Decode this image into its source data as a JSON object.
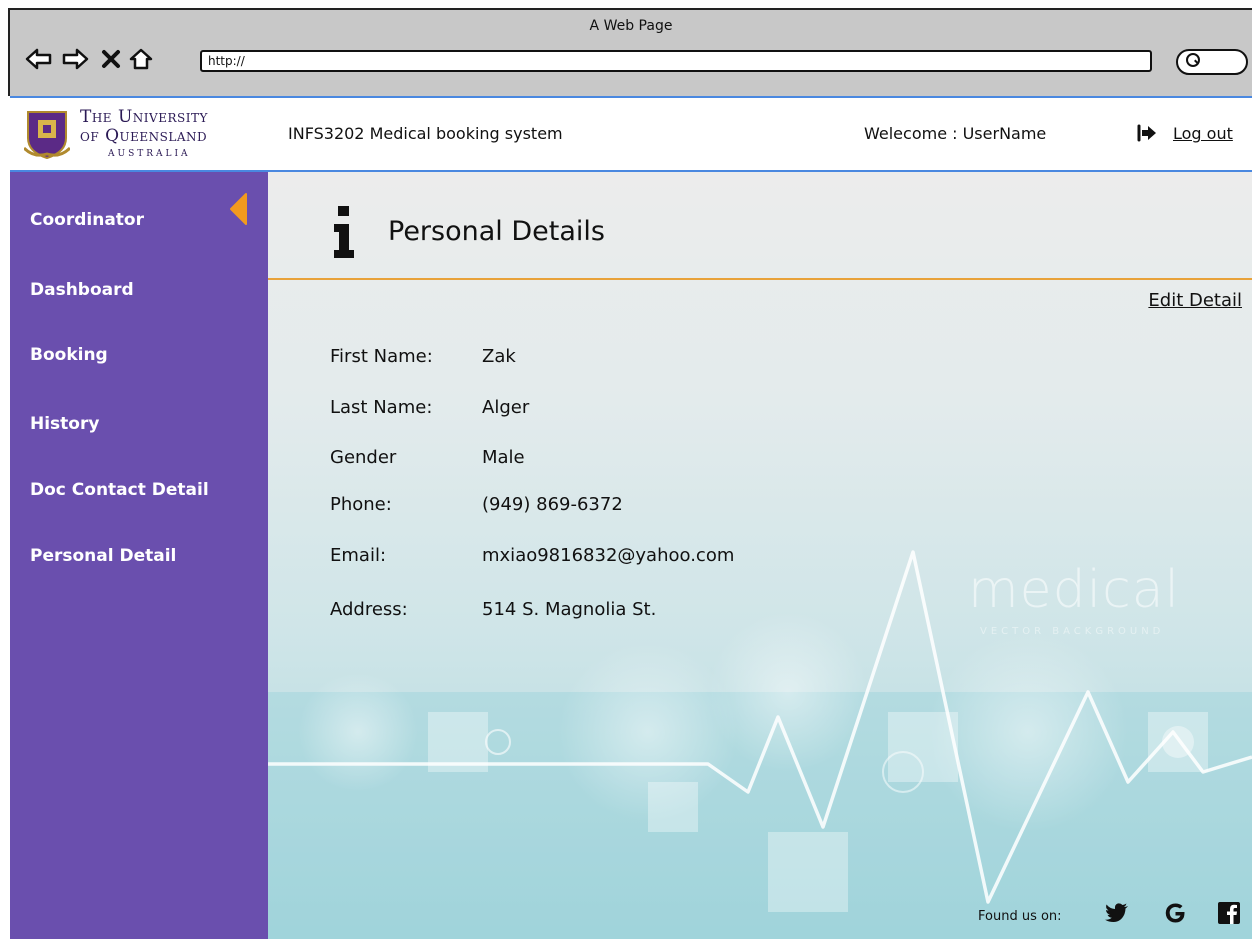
{
  "browser": {
    "title": "A Web Page",
    "url": "http://"
  },
  "header": {
    "logo": {
      "line1": "The University",
      "line2": "of Queensland",
      "line3": "AUSTRALIA"
    },
    "app_title": "INFS3202 Medical booking system",
    "welcome": "Welecome :  UserName",
    "logout_label": "Log out"
  },
  "sidebar": {
    "items": [
      {
        "label": "Coordinator"
      },
      {
        "label": "Dashboard"
      },
      {
        "label": "Booking"
      },
      {
        "label": "History"
      },
      {
        "label": "Doc Contact Detail"
      },
      {
        "label": "Personal Detail"
      }
    ],
    "accent_color": "#f29a1e",
    "background_color": "#6a4fae"
  },
  "main": {
    "page_title": "Personal Details",
    "edit_label": "Edit Detail",
    "fields": [
      {
        "label": "First Name:",
        "value": "Zak"
      },
      {
        "label": "Last Name:",
        "value": "Alger"
      },
      {
        "label": "Gender",
        "value": "Male"
      },
      {
        "label": "Phone:",
        "value": "(949) 869-6372"
      },
      {
        "label": "Email:",
        "value": "mxiao9816832@yahoo.com"
      },
      {
        "label": "Address:",
        "value": "514 S. Magnolia St."
      }
    ],
    "background_watermark": {
      "big": "medical",
      "small": "VECTOR BACKGROUND"
    }
  },
  "footer": {
    "found_us": "Found us on:",
    "social_icons": [
      "twitter-icon",
      "google-icon",
      "facebook-icon"
    ]
  }
}
